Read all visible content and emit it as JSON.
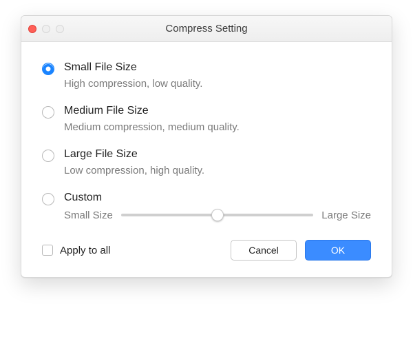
{
  "window": {
    "title": "Compress Setting"
  },
  "options": [
    {
      "title": "Small File Size",
      "desc": "High compression, low quality.",
      "selected": true
    },
    {
      "title": "Medium File Size",
      "desc": "Medium compression, medium quality.",
      "selected": false
    },
    {
      "title": "Large File Size",
      "desc": "Low compression, high quality.",
      "selected": false
    }
  ],
  "custom": {
    "title": "Custom",
    "slider_min_label": "Small Size",
    "slider_max_label": "Large Size",
    "selected": false
  },
  "footer": {
    "apply_label": "Apply to all",
    "cancel_label": "Cancel",
    "ok_label": "OK"
  }
}
